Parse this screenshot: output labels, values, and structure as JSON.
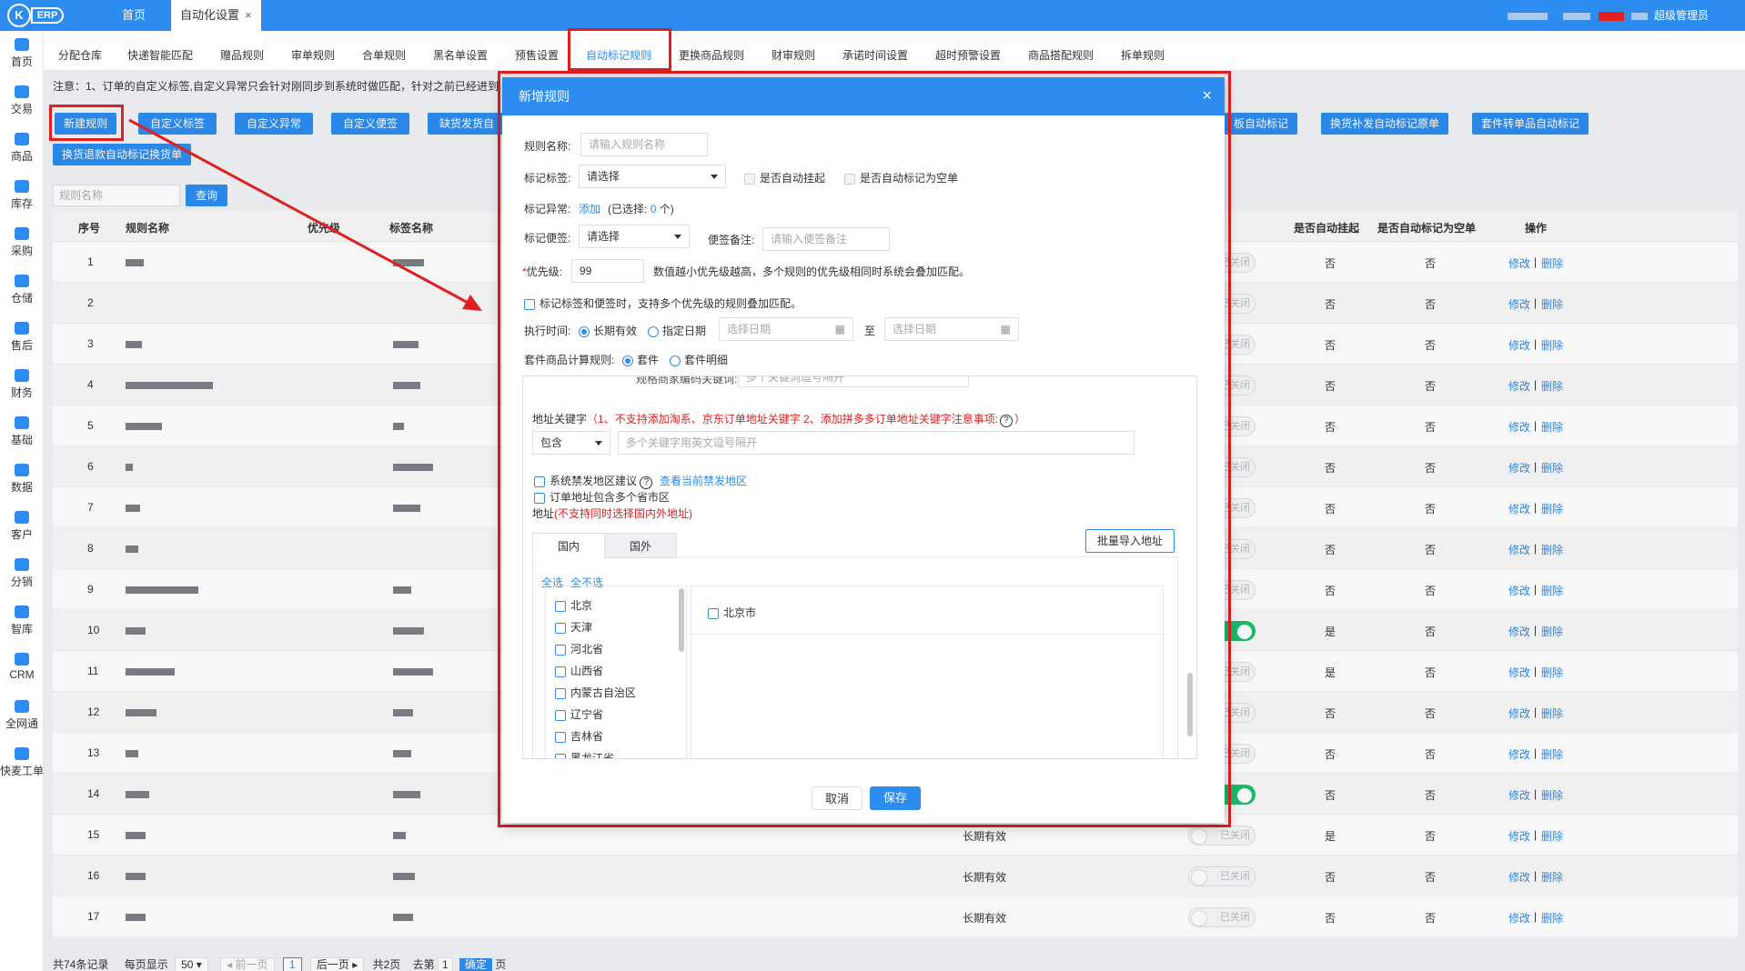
{
  "app": {
    "logo_letter": "K",
    "logo_text": "ERP",
    "top_tabs": [
      {
        "label": "首页"
      },
      {
        "label": "自动化设置"
      }
    ],
    "close_glyph": "×",
    "user_label": "超级管理员"
  },
  "sidebar": {
    "items": [
      {
        "label": "首页",
        "icon": "home-icon"
      },
      {
        "label": "交易",
        "icon": "trade-icon"
      },
      {
        "label": "商品",
        "icon": "goods-icon"
      },
      {
        "label": "库存",
        "icon": "stock-icon"
      },
      {
        "label": "采购",
        "icon": "cart-icon"
      },
      {
        "label": "仓储",
        "icon": "warehouse-icon"
      },
      {
        "label": "售后",
        "icon": "aftersale-icon"
      },
      {
        "label": "财务",
        "icon": "finance-icon"
      },
      {
        "label": "基础",
        "icon": "gear-icon"
      },
      {
        "label": "数据",
        "icon": "monitor-icon"
      },
      {
        "label": "客户",
        "icon": "user-icon"
      },
      {
        "label": "分销",
        "icon": "distribution-icon"
      },
      {
        "label": "智库",
        "icon": "library-icon"
      },
      {
        "label": "CRM",
        "icon": "mail-icon"
      },
      {
        "label": "全网通",
        "icon": "network-icon"
      },
      {
        "label": "快麦工单",
        "icon": "ticket-icon"
      }
    ]
  },
  "subtabs": [
    {
      "label": "分配仓库"
    },
    {
      "label": "快递智能匹配"
    },
    {
      "label": "赠品规则"
    },
    {
      "label": "审单规则"
    },
    {
      "label": "合单规则"
    },
    {
      "label": "黑名单设置"
    },
    {
      "label": "预售设置"
    },
    {
      "label": "自动标记规则"
    },
    {
      "label": "更换商品规则"
    },
    {
      "label": "财审规则"
    },
    {
      "label": "承诺时间设置"
    },
    {
      "label": "超时预警设置"
    },
    {
      "label": "商品搭配规则"
    },
    {
      "label": "拆单规则"
    }
  ],
  "notice": "注意：1、订单的自定义标签,自定义异常只会针对刚同步到系统时做匹配，针对之前已经进到",
  "toolbar": {
    "new_rule": "新建规则",
    "custom_tag": "自定义标签",
    "custom_exception": "自定义异常",
    "custom_note": "自定义便签",
    "out_of_stock": "缺货发货自",
    "board_auto": "板自动标记",
    "exchange_auto": "换货补发自动标记原单",
    "kit_auto": "套件转单品自动标记",
    "return_exchange": "换货退款自动标记换货单"
  },
  "search": {
    "placeholder": "规则名称",
    "button": "查询"
  },
  "table": {
    "headers": {
      "index": "序号",
      "rule_name": "规则名称",
      "priority": "优先级",
      "tag_name": "标签名称",
      "auto_hold": "是否自动挂起",
      "auto_empty": "是否自动标记为空单",
      "actions": "操作"
    },
    "edit": "修改",
    "delete": "删除",
    "divider": "|",
    "switch_off": "已关闭",
    "rows": [
      {
        "idx": "1",
        "hold": "否",
        "empty": "否",
        "valid": "",
        "on": false
      },
      {
        "idx": "2",
        "hold": "否",
        "empty": "否",
        "valid": "",
        "on": false
      },
      {
        "idx": "3",
        "hold": "否",
        "empty": "否",
        "valid": "",
        "on": false
      },
      {
        "idx": "4",
        "hold": "否",
        "empty": "否",
        "valid": "",
        "on": false
      },
      {
        "idx": "5",
        "hold": "否",
        "empty": "否",
        "valid": "",
        "on": false
      },
      {
        "idx": "6",
        "hold": "否",
        "empty": "否",
        "valid": "",
        "on": false
      },
      {
        "idx": "7",
        "hold": "否",
        "empty": "否",
        "valid": "",
        "on": false
      },
      {
        "idx": "8",
        "hold": "否",
        "empty": "否",
        "valid": "",
        "on": false
      },
      {
        "idx": "9",
        "hold": "否",
        "empty": "否",
        "valid": "",
        "on": false
      },
      {
        "idx": "10",
        "hold": "是",
        "empty": "否",
        "valid": "",
        "on": true
      },
      {
        "idx": "11",
        "hold": "是",
        "empty": "否",
        "valid": "",
        "on": false
      },
      {
        "idx": "12",
        "hold": "否",
        "empty": "否",
        "valid": "",
        "on": false
      },
      {
        "idx": "13",
        "hold": "否",
        "empty": "否",
        "valid": "",
        "on": false
      },
      {
        "idx": "14",
        "hold": "否",
        "empty": "否",
        "valid": "",
        "on": true
      },
      {
        "idx": "15",
        "hold": "是",
        "empty": "否",
        "valid": "长期有效",
        "on": false
      },
      {
        "idx": "16",
        "hold": "否",
        "empty": "否",
        "valid": "长期有效",
        "on": false
      },
      {
        "idx": "17",
        "hold": "否",
        "empty": "否",
        "valid": "长期有效",
        "on": false
      }
    ]
  },
  "pager": {
    "total": "共74条记录",
    "per_page_label": "每页显示",
    "per_page": "50",
    "prev": "前一页",
    "page": "1",
    "next": "后一页",
    "pages": "共2页",
    "goto_label": "去第",
    "goto_value": "1",
    "confirm": "确定",
    "goto_suffix": "页"
  },
  "modal": {
    "title": "新增规则",
    "close": "×",
    "rule_name_label": "规则名称:",
    "rule_name_placeholder": "请输入规则名称",
    "tag_label": "标记标签:",
    "tag_select": "请选择",
    "auto_hold": "是否自动挂起",
    "auto_empty": "是否自动标记为空单",
    "exception_label": "标记异常:",
    "exception_add": "添加",
    "exception_selected_pre": "(已选择:",
    "exception_selected_count": "0",
    "exception_selected_post": "个)",
    "note_label": "标记便签:",
    "note_select": "请选择",
    "note_remark_label": "便签备注:",
    "note_remark_placeholder": "请输入便签备注",
    "priority_star": "*",
    "priority_label": "优先级:",
    "priority_value": "99",
    "priority_hint": "数值越小优先级越高，多个规则的优先级相同时系统会叠加匹配。",
    "overlay_check": "标记标签和便签时，支持多个优先级的规则叠加匹配。",
    "exec_time_label": "执行时间:",
    "long_term": "长期有效",
    "specified_date": "指定日期",
    "date_placeholder": "选择日期",
    "to": "至",
    "kit_calc_label": "套件商品计算规则:",
    "kit": "套件",
    "kit_detail": "套件明细",
    "clipped_label": "规格商家编码关键词:",
    "clipped_placeholder": "多个关键词逗号隔开",
    "addr_kw_label": "地址关键字",
    "addr_kw_warn": "（1、不支持添加淘系、京东订单地址关键字   2、添加拼多多订单地址关键字注意事项:",
    "addr_kw_warn_end": "）",
    "help_glyph": "?",
    "contains_select": "包含",
    "kw_placeholder": "多个关键字用英文逗号隔开",
    "sys_forbidden": "系统禁发地区建议",
    "view_forbidden": "查看当前禁发地区",
    "multi_province": "订单地址包含多个省市区",
    "address_label": "地址",
    "address_warn": "(不支持同时选择国内外地址)",
    "batch_import": "批量导入地址",
    "tab_domestic": "国内",
    "tab_foreign": "国外",
    "select_all": "全选",
    "select_none": "全不选",
    "provinces": [
      "北京",
      "天津",
      "河北省",
      "山西省",
      "内蒙古自治区",
      "辽宁省",
      "吉林省",
      "黑龙江省"
    ],
    "city": "北京市",
    "cancel": "取消",
    "save": "保存"
  }
}
